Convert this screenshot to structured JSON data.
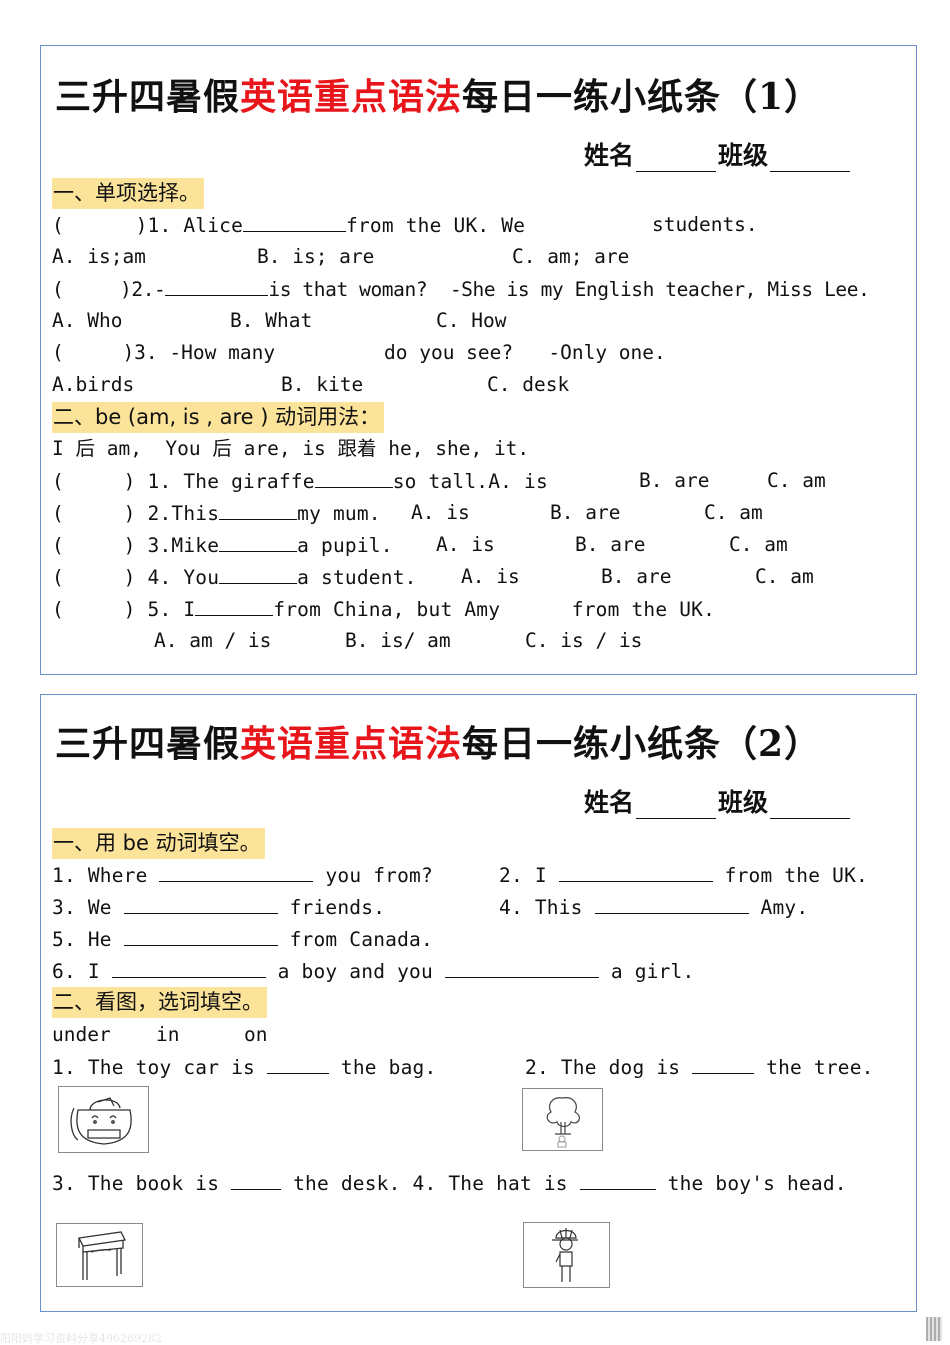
{
  "sheets": [
    {
      "title_prefix": "三升四暑假",
      "title_highlight": "英语重点语法",
      "title_suffix": "每日一练小纸条（1）",
      "name_label": "姓名",
      "class_label": "班级",
      "section1": {
        "heading": "一、单项选择。",
        "q1": {
          "lead": "(      )1. Alice",
          "mid": "from the UK. We",
          "tail": "students.",
          "options": [
            "A. is;am",
            "B. is; are",
            "C. am; are"
          ]
        },
        "q2": {
          "lead": "(     )2.-",
          "tail": "is that woman?  -She is my English teacher, Miss Lee.",
          "options": [
            "A. Who",
            "B. What",
            "C. How"
          ]
        },
        "q3": {
          "lead": "(     )3. -How many",
          "tail": "do you see?   -Only one.",
          "options": [
            "A.birds",
            "B. kite",
            "C. desk"
          ]
        }
      },
      "section2": {
        "heading": "二、be (am, is , are ) 动词用法：",
        "rule": "I 后 am,  You 后 are, is 跟着 he, she, it.",
        "questions": [
          {
            "lead": "(     ) 1. The giraffe",
            "tail": "so tall.",
            "options": [
              "A. is",
              "B. are",
              "C. am"
            ]
          },
          {
            "lead": "(     ) 2.This",
            "tail": "my mum.",
            "options": [
              "A. is",
              "B. are",
              "C. am"
            ]
          },
          {
            "lead": "(     ) 3.Mike",
            "tail": "a pupil.",
            "options": [
              "A. is",
              "B. are",
              "C. am"
            ]
          },
          {
            "lead": "(     ) 4. You",
            "tail": "a student.",
            "options": [
              "A. is",
              "B. are",
              "C. am"
            ]
          },
          {
            "lead": "(     ) 5. I",
            "tail": "from China, but Amy      from the UK.",
            "options": [
              "A. am / is",
              "B. is/ am",
              "C. is / is"
            ]
          }
        ]
      }
    },
    {
      "title_prefix": "三升四暑假",
      "title_highlight": "英语重点语法",
      "title_suffix": "每日一练小纸条（2）",
      "name_label": "姓名",
      "class_label": "班级",
      "section1": {
        "heading": "一、用 be 动词填空。",
        "items": [
          {
            "lead": "1. Where",
            "tail": "you from?"
          },
          {
            "lead": "2. I",
            "tail": "from the UK."
          },
          {
            "lead": "3. We",
            "tail": "friends."
          },
          {
            "lead": "4. This",
            "tail": "Amy."
          },
          {
            "lead": "5. He",
            "tail": "from Canada."
          },
          {
            "lead": "6. I",
            "mid": "a boy and you",
            "tail": "a girl."
          }
        ]
      },
      "section2": {
        "heading": "二、看图，选词填空。",
        "word_bank": [
          "under",
          "in",
          "on"
        ],
        "items": [
          {
            "lead": "1. The toy car is",
            "tail": "the bag.",
            "image": "toy-car-in-bag"
          },
          {
            "lead": "2. The dog is",
            "tail": "the tree.",
            "image": "dog-under-tree"
          },
          {
            "lead": "3. The book is",
            "tail": "the desk.",
            "image": "book-in-desk"
          },
          {
            "lead": "4. The hat is",
            "tail": "the boy's head.",
            "image": "hat-on-boy"
          }
        ]
      }
    }
  ],
  "footer": {
    "watermark": "阳阳妈学习资料分享496269282",
    "qr_code": "qr-code"
  }
}
